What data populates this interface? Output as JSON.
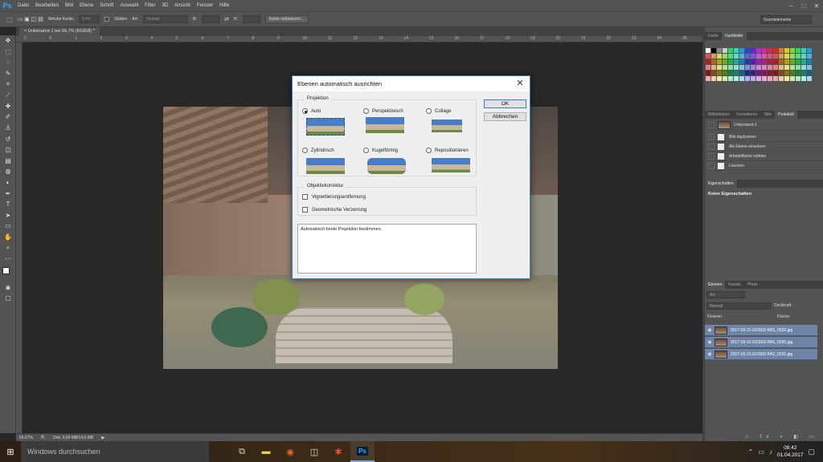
{
  "app": {
    "logo": "Ps"
  },
  "menu": [
    "Datei",
    "Bearbeiten",
    "Bild",
    "Ebene",
    "Schrift",
    "Auswahl",
    "Filter",
    "3D",
    "Ansicht",
    "Fenster",
    "Hilfe"
  ],
  "window_controls": {
    "minimize": "–",
    "maximize": "□",
    "close": "✕"
  },
  "options": {
    "soft_edge_label": "Weiche Kante:",
    "soft_edge_value": "0 Px",
    "smooth_label": "Glätten",
    "style_label": "Art:",
    "style_value": "Normal",
    "width_label": "B:",
    "height_label": "H:",
    "refine_button": "Kante verbessern...",
    "workspace": "Grundelemente"
  },
  "document_tab": {
    "title": "Unbenannt-1 bei 66,7% (RGB/8) *",
    "close": "×"
  },
  "ruler_numbers": [
    "5",
    "0",
    "1",
    "2",
    "3",
    "4",
    "5",
    "6",
    "7",
    "8",
    "9",
    "10",
    "11",
    "12",
    "13",
    "14",
    "15",
    "16",
    "17",
    "18",
    "19",
    "20",
    "21",
    "22",
    "23",
    "24",
    "25"
  ],
  "status": {
    "zoom": "66,67%",
    "doc": "Dok: 3,64 MB/14,6 MB",
    "arrow": "▶"
  },
  "panels": {
    "color_tabs": [
      "Farbe",
      "Farbfelder"
    ],
    "history_tabs": [
      "Bibliotheken",
      "Korrekturen",
      "Stile",
      "Protokoll"
    ],
    "history_snapshot": "Unbenannt-1",
    "history_items": [
      "Bild duplizieren",
      "Als Ebene einsetzen",
      "Arbeitsfläche wählen",
      "Löschen"
    ],
    "properties_tab": "Eigenschaften",
    "properties_text": "Keine Eigenschaften",
    "layers_tabs": [
      "Ebenen",
      "Kanäle",
      "Pfade"
    ],
    "layer_kind": "Art",
    "blend_mode": "Normal",
    "opacity_label": "Deckkraft:",
    "lock_label": "Fixieren:",
    "fill_label": "Fläche:",
    "layers": [
      "2017-03-31-EOS6D-IMG_0029.jpg",
      "2017-03-31-EOS6D-IMG_0030.jpg",
      "2017-03-31-EOS6D-IMG_0031.jpg"
    ]
  },
  "dialog": {
    "title": "Ebenen automatisch ausrichten",
    "close": "✕",
    "projection_title": "Projektion",
    "options": [
      "Auto",
      "Perspektivisch",
      "Collage",
      "Zylindrisch",
      "Kugelförmig",
      "Repositionieren"
    ],
    "selected": "Auto",
    "lens_title": "Objektivkorrektur",
    "lens_options": [
      "Vignettierungsentfernung",
      "Geometrische Verzerrung"
    ],
    "ok": "OK",
    "cancel": "Abbrechen",
    "description": "Automatisch beste Projektion bestimmen."
  },
  "taskbar": {
    "search": "Windows durchsuchen",
    "time": "08:42",
    "date": "01.04.2017"
  },
  "colors": {
    "accent": "#3a7bd5",
    "panel": "#535353",
    "layer_selected": "#6f85a8"
  }
}
